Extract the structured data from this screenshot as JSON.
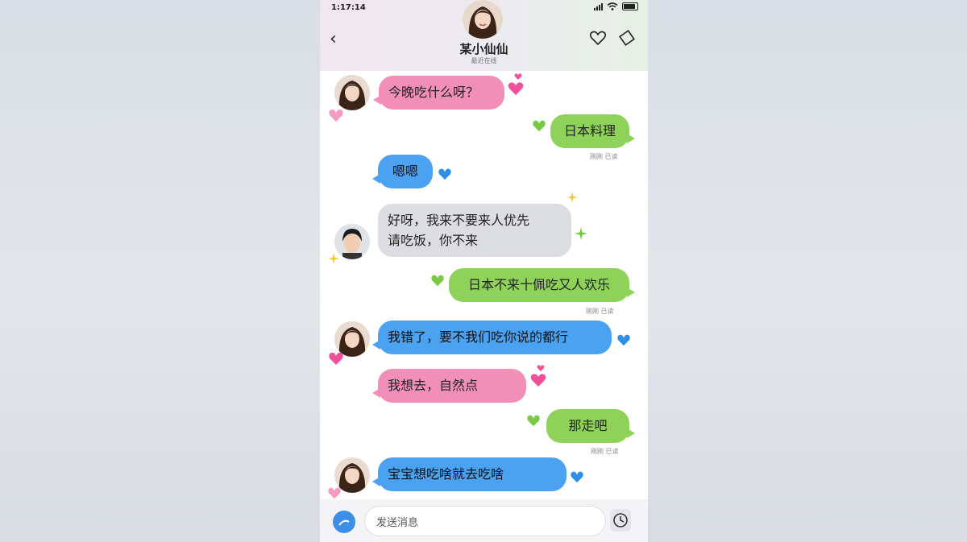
{
  "status_bar": {
    "time": "1:17:14"
  },
  "header": {
    "name": "某小仙仙",
    "subtitle": "最近在线"
  },
  "messages": [
    {
      "text": "今晚吃什么呀？"
    },
    {
      "text": "日本料理",
      "time": "刚刚 已读"
    },
    {
      "text": "嗯嗯"
    },
    {
      "text": "好呀，我来不要来人优先",
      "text2": "请吃饭，你不来"
    },
    {
      "text": "日本不来十佩吃又人欢乐",
      "time": "刚刚 已读"
    },
    {
      "text": "我错了，要不我们吃你说的都行"
    },
    {
      "text": "我想去，自然点"
    },
    {
      "text": "那走吧",
      "time": "刚刚 已读"
    },
    {
      "text": "宝宝想吃啥就去吃啥"
    }
  ],
  "input": {
    "placeholder": "发送消息"
  },
  "colors": {
    "pink": "#f28fb8",
    "blue": "#4aa2f0",
    "gray": "#dcdde0",
    "green": "#8fd25a"
  }
}
